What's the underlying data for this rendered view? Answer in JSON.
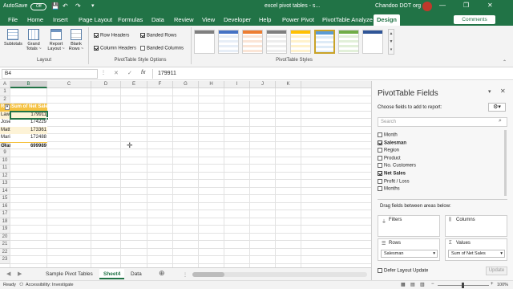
{
  "titlebar": {
    "autosave_label": "AutoSave",
    "autosave_state": "Off",
    "doc_title": "excel pivot tables - s...",
    "search_placeholder": "Search",
    "user": "Chandoo DOT org"
  },
  "tabs": [
    "File",
    "Home",
    "Insert",
    "Page Layout",
    "Formulas",
    "Data",
    "Review",
    "View",
    "Developer",
    "Help",
    "Power Pivot",
    "PivotTable Analyze",
    "Design"
  ],
  "comments_label": "Comments",
  "ribbon": {
    "layout_buttons": [
      {
        "l1": "Subtotals",
        "l2": ""
      },
      {
        "l1": "Grand",
        "l2": "Totals ~"
      },
      {
        "l1": "Report",
        "l2": "Layout ~"
      },
      {
        "l1": "Blank",
        "l2": "Rows ~"
      }
    ],
    "layout_group": "Layout",
    "options": [
      {
        "label": "Row Headers",
        "checked": true
      },
      {
        "label": "Banded Rows",
        "checked": true
      },
      {
        "label": "Column Headers",
        "checked": true
      },
      {
        "label": "Banded Columns",
        "checked": false
      }
    ],
    "options_group": "PivotTable Style Options",
    "styles_group": "PivotTable Styles"
  },
  "formula_bar": {
    "name_box": "B4",
    "cancel": "✕",
    "enter": "✓",
    "fx": "fx",
    "value": "179911"
  },
  "columns": [
    "A",
    "B",
    "C",
    "D",
    "E",
    "F",
    "G",
    "H",
    "I",
    "J",
    "K"
  ],
  "rows": [
    "1",
    "2",
    "3",
    "4",
    "5",
    "6",
    "7",
    "8",
    "9",
    "10",
    "11",
    "12",
    "13",
    "14",
    "15",
    "16",
    "17",
    "18",
    "19",
    "20",
    "21",
    "22",
    "23"
  ],
  "pivot": {
    "header_labels": "Row Labels",
    "header_values": "Sum of Net Sales",
    "rows": [
      {
        "name": "Lawrence",
        "value": "179911"
      },
      {
        "name": "Joseph",
        "value": "174229"
      },
      {
        "name": "Matt",
        "value": "173361"
      },
      {
        "name": "Maria",
        "value": "172488"
      }
    ],
    "total_label": "Grand Total",
    "total_value": "699989"
  },
  "sheet_tabs": [
    "Sample Pivot Tables",
    "Sheet4",
    "Data"
  ],
  "status": {
    "ready": "Ready",
    "accessibility": "Accessibility: Investigate",
    "zoom": "100%"
  },
  "pane": {
    "title": "PivotTable Fields",
    "choose": "Choose fields to add to report:",
    "search_placeholder": "Search",
    "fields": [
      {
        "name": "Month",
        "checked": false
      },
      {
        "name": "Salesman",
        "checked": true
      },
      {
        "name": "Region",
        "checked": false
      },
      {
        "name": "Product",
        "checked": false
      },
      {
        "name": "No. Customers",
        "checked": false
      },
      {
        "name": "Net Sales",
        "checked": true
      },
      {
        "name": "Profit / Loss",
        "checked": false
      },
      {
        "name": "Months",
        "checked": false
      }
    ],
    "drag_label": "Drag fields between areas below:",
    "areas": {
      "filters": "Filters",
      "columns": "Columns",
      "rows": "Rows",
      "values": "Values"
    },
    "rows_item": "Salesman",
    "values_item": "Sum of Net Sales",
    "defer": "Defer Layout Update",
    "update": "Update"
  },
  "colors": {
    "excel_green": "#217346",
    "pivot_header": "#f5c242",
    "pivot_band": "#fdf3d7"
  }
}
